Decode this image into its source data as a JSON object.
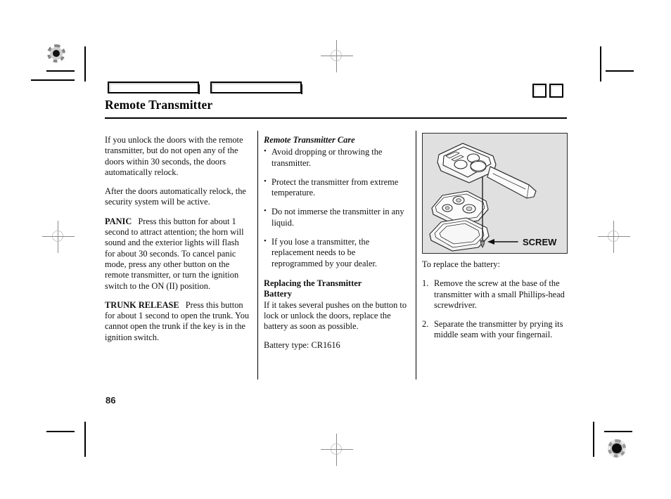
{
  "document": {
    "page_number": "86",
    "title": "Remote Transmitter"
  },
  "header": {
    "bar_left_label": "",
    "bar_right_label": "",
    "marker_square_1": "",
    "marker_square_2": ""
  },
  "columns": {
    "left": {
      "paragraph_1": "If you unlock the doors with the remote transmitter, but do not open any of the doors within 30 seconds, the doors automatically relock.",
      "paragraph_2": "After the doors automatically relock, the security system will be active.",
      "panic_term": "PANIC",
      "panic_text": "Press this button for about 1 second to attract attention; the horn will sound and the exterior lights will flash for about 30 seconds. To cancel panic mode, press any other button on the remote transmitter, or turn the ignition switch to the ON (II) position.",
      "trunk_term": "TRUNK RELEASE",
      "trunk_text": "Press this button for about 1 second to open the trunk. You cannot open the trunk if the key is in the ignition switch."
    },
    "middle": {
      "care_heading": "Remote Transmitter Care",
      "care_items": [
        "Avoid dropping or throwing the transmitter.",
        "Protect the transmitter from extreme temperature.",
        "Do not immerse the transmitter in any liquid.",
        "If you lose a transmitter, the replacement needs to be reprogrammed by your dealer."
      ],
      "battery_heading_line1": "Replacing the Transmitter",
      "battery_heading_line2": "Battery",
      "battery_paragraph": "If it takes several pushes on the button to lock or unlock the doors, replace the battery as soon as possible.",
      "battery_type": "Battery type: CR1616"
    },
    "right": {
      "figure_callout": "SCREW",
      "intro": "To replace the battery:",
      "steps": [
        "Remove the screw at the base of the transmitter with a small Phillips-head screwdriver.",
        "Separate the transmitter by prying its middle seam with your fingernail."
      ]
    }
  },
  "figure": {
    "caption": "SCREW",
    "background_color": "#e0e0e0",
    "border_color": "#2b2b2b"
  }
}
